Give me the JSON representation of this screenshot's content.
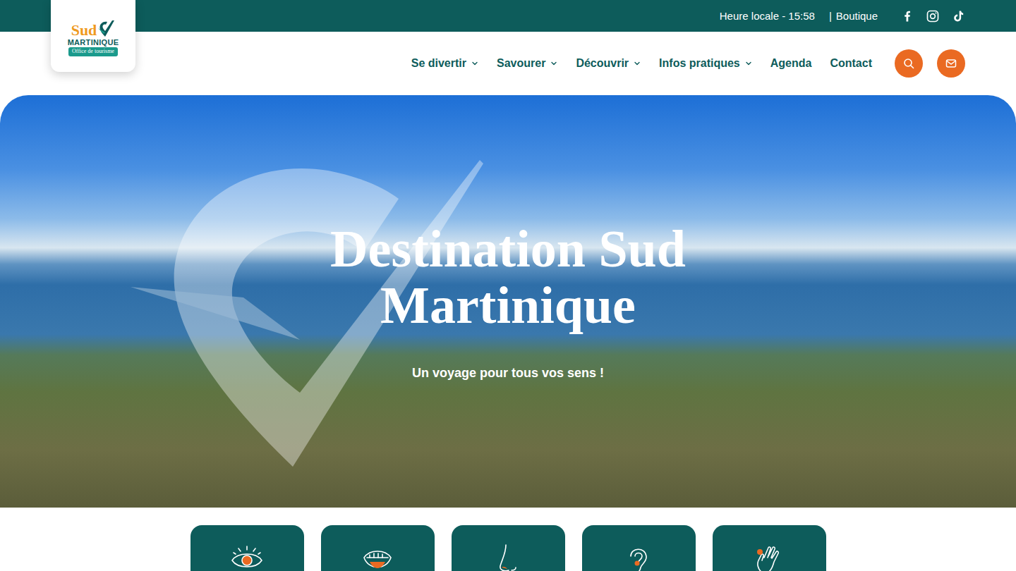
{
  "topbar": {
    "local_time": "Heure locale - 15:58",
    "separator": "|",
    "shop": "Boutique"
  },
  "logo": {
    "line1": "Sud",
    "line2": "MARTINIQUE",
    "line3": "Office de tourisme"
  },
  "nav": {
    "items": [
      {
        "label": "Se divertir",
        "dropdown": true
      },
      {
        "label": "Savourer",
        "dropdown": true
      },
      {
        "label": "Découvrir",
        "dropdown": true
      },
      {
        "label": "Infos pratiques",
        "dropdown": true
      },
      {
        "label": "Agenda",
        "dropdown": false
      },
      {
        "label": "Contact",
        "dropdown": false
      }
    ]
  },
  "hero": {
    "title": "Destination Sud Martinique",
    "subtitle": "Un voyage pour tous vos sens !"
  }
}
